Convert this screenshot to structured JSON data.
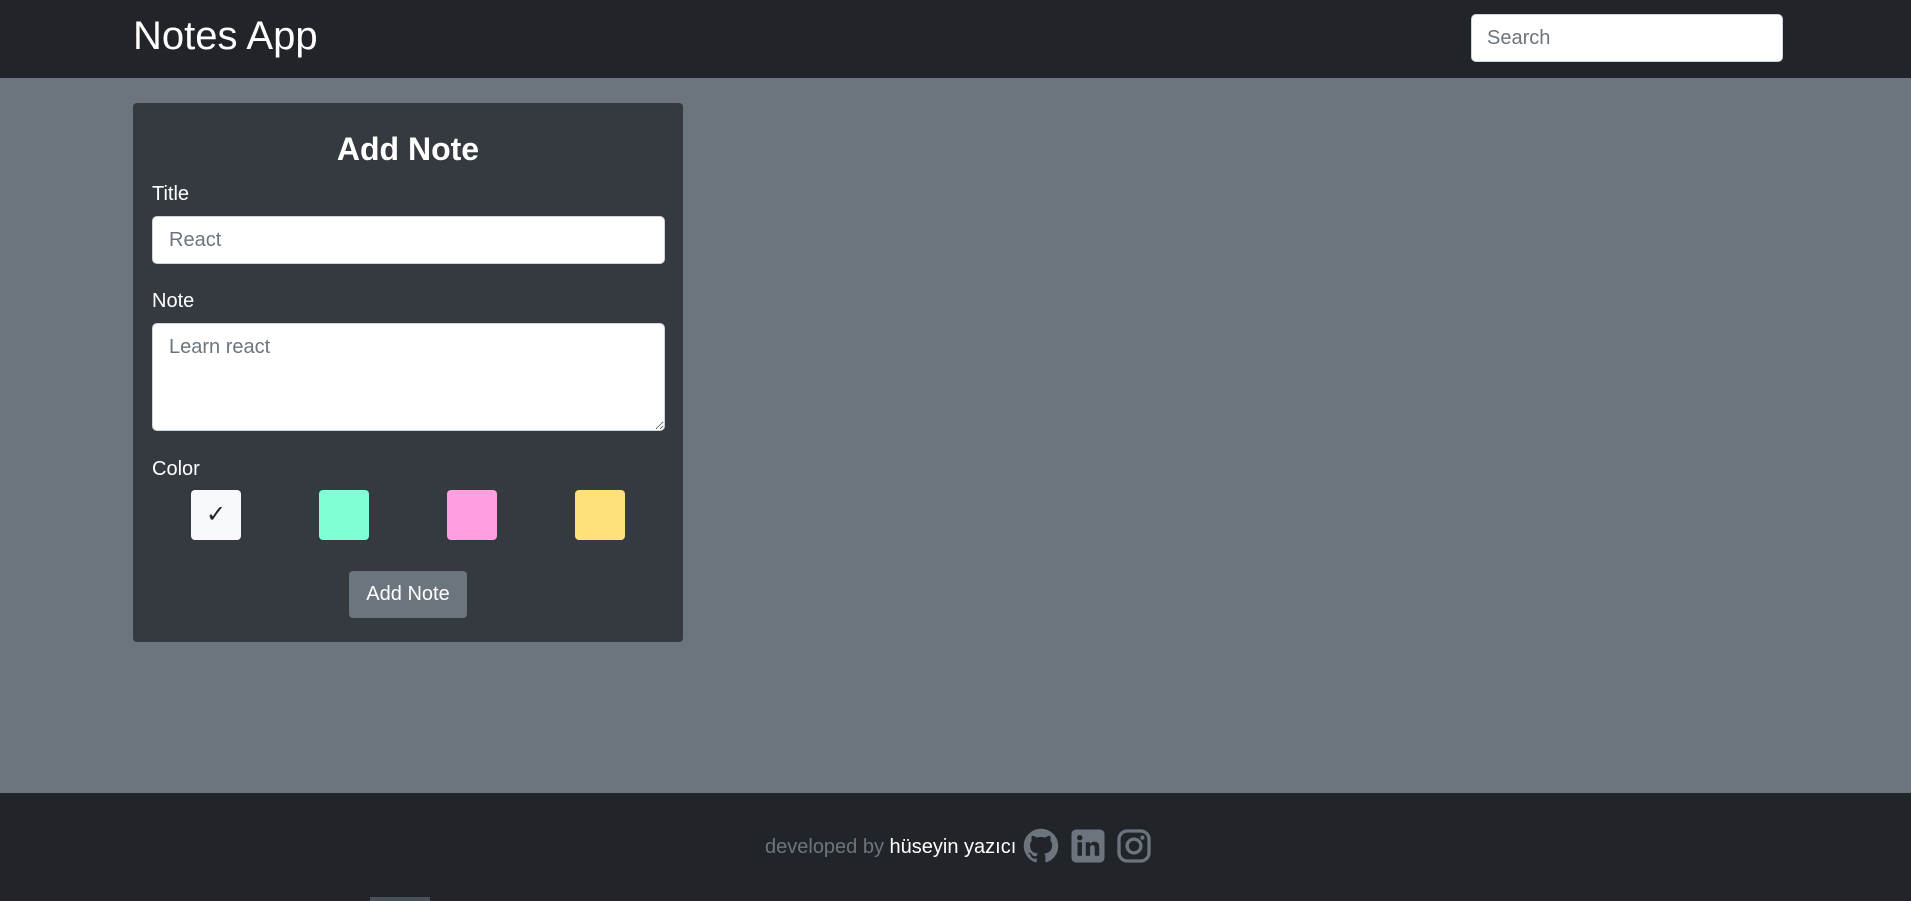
{
  "navbar": {
    "brand": "Notes App",
    "search_placeholder": "Search"
  },
  "form": {
    "heading": "Add Note",
    "title_label": "Title",
    "title_placeholder": "React",
    "note_label": "Note",
    "note_placeholder": "Learn react",
    "color_label": "Color",
    "colors": [
      {
        "name": "white",
        "hex": "#f8f9fa",
        "selected": true
      },
      {
        "name": "mint",
        "hex": "#7fffd4",
        "selected": false
      },
      {
        "name": "pink",
        "hex": "#ff9fe0",
        "selected": false
      },
      {
        "name": "yellow",
        "hex": "#ffe07a",
        "selected": false
      }
    ],
    "check_mark": "✓",
    "submit_label": "Add Note"
  },
  "footer": {
    "prefix": "developed by",
    "author": "hüseyin yazıcı",
    "icons": [
      "github-icon",
      "linkedin-icon",
      "instagram-icon"
    ],
    "icon_color": "#6c757d"
  }
}
